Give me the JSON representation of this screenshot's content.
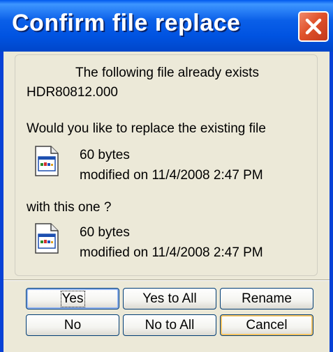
{
  "window": {
    "title": "Confirm file replace"
  },
  "dialog": {
    "heading": "The following file already exists",
    "filename": "HDR80812.000",
    "question": "Would you like to replace the existing file",
    "existing_file": {
      "size": "60 bytes",
      "modified": "modified on 11/4/2008 2:47 PM",
      "icon": "document-icon"
    },
    "with_text": "with this one ?",
    "new_file": {
      "size": "60 bytes",
      "modified": "modified on 11/4/2008 2:47 PM",
      "icon": "document-icon"
    }
  },
  "buttons": {
    "yes": "Yes",
    "yes_to_all": "Yes to All",
    "rename": "Rename",
    "no": "No",
    "no_to_all": "No to All",
    "cancel": "Cancel"
  },
  "colors": {
    "titlebar": "#0053e1",
    "close_button": "#e0522b",
    "dialog_bg": "#ece9d8"
  }
}
